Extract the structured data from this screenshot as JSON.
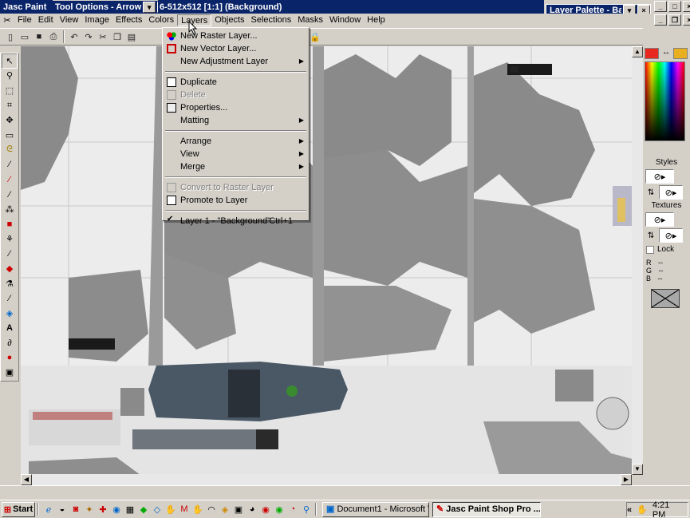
{
  "app_title": "Jasc Paint",
  "tool_options": {
    "title": "Tool Options - Arrow"
  },
  "document_title": "6-512x512 [1:1] (Background)",
  "layer_palette": {
    "title": "Layer Palette - Backg"
  },
  "menubar": [
    "File",
    "Edit",
    "View",
    "Image",
    "Effects",
    "Colors",
    "Layers",
    "Objects",
    "Selections",
    "Masks",
    "Window",
    "Help"
  ],
  "layers_menu": {
    "new_raster": "New Raster Layer...",
    "new_vector": "New Vector Layer...",
    "new_adjustment": "New Adjustment Layer",
    "duplicate": "Duplicate",
    "delete": "Delete",
    "properties": "Properties...",
    "matting": "Matting",
    "arrange": "Arrange",
    "view": "View",
    "merge": "Merge",
    "convert": "Convert to Raster Layer",
    "promote": "Promote to Layer",
    "layer_entry": "Layer 1 - \"Background\"",
    "layer_shortcut": "Ctrl+1"
  },
  "palette": {
    "styles_label": "Styles",
    "textures_label": "Textures",
    "lock_label": "Lock",
    "r_label": "R",
    "g_label": "G",
    "b_label": "B",
    "r_value": "--",
    "g_value": "--",
    "b_value": "--"
  },
  "taskbar": {
    "start": "Start",
    "word_task": "Document1 - Microsoft W...",
    "psp_task": "Jasc Paint Shop Pro ...",
    "tray_chevron": "«",
    "clock": "4:21 PM"
  },
  "colors": {
    "title_active": "#0a246a",
    "title_inactive": "#808080",
    "fg_swatch": "#e8281e",
    "bg_swatch": "#e8b020"
  }
}
